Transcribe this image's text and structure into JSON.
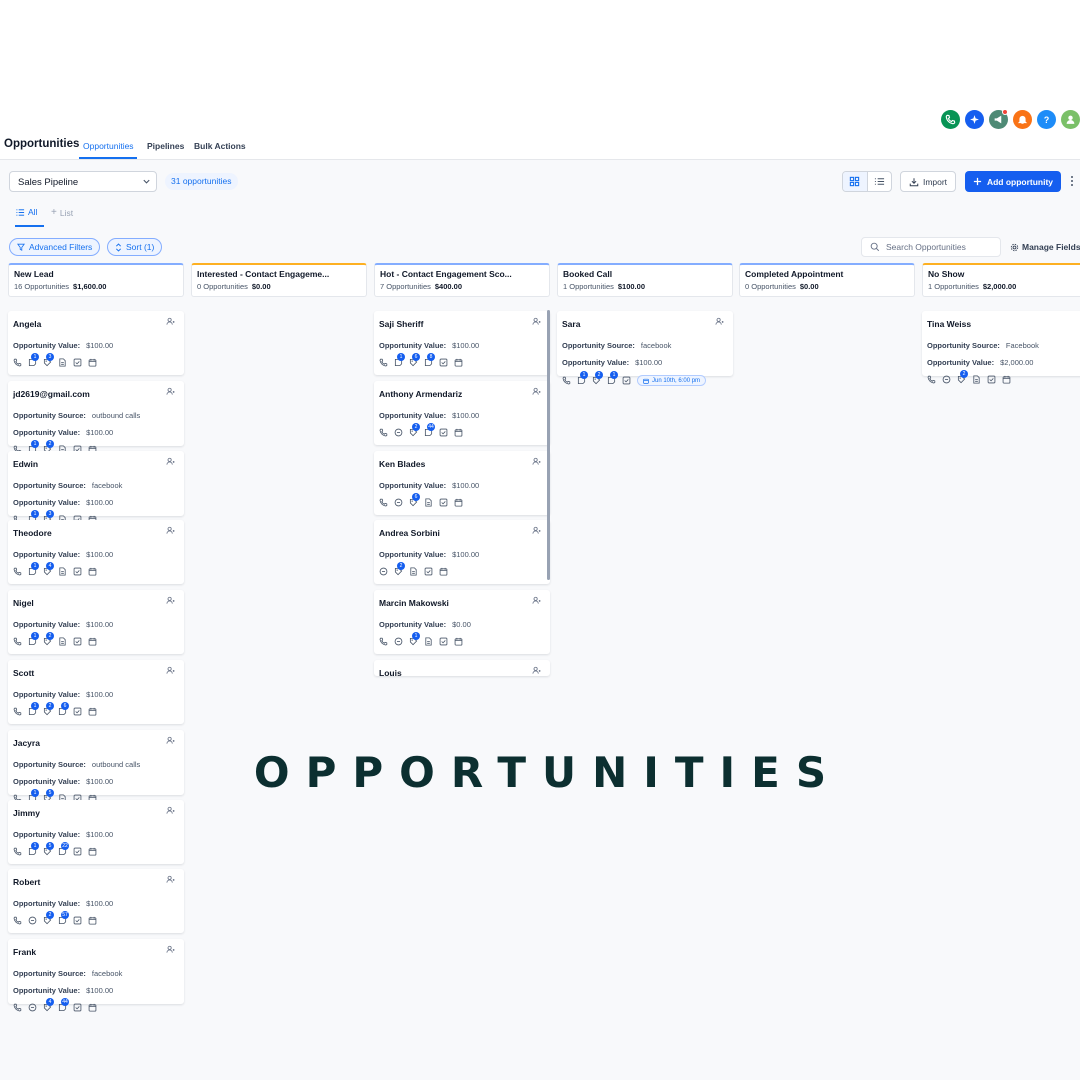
{
  "header": {
    "title": "Opportunities",
    "tabs": [
      {
        "label": "Opportunities",
        "active": true
      },
      {
        "label": "Pipelines",
        "active": false
      },
      {
        "label": "Bulk Actions",
        "active": false
      }
    ]
  },
  "top_icons": [
    {
      "icon": "phone-icon",
      "color": "#079455"
    },
    {
      "icon": "sparkle-icon",
      "color": "#155eef"
    },
    {
      "icon": "megaphone-icon",
      "color": "#4e8a75"
    },
    {
      "icon": "bell-icon",
      "color": "#f97316"
    },
    {
      "icon": "help-icon",
      "color": "#1d8cf8"
    },
    {
      "icon": "user-icon",
      "color": "#7ac068"
    }
  ],
  "toolbar": {
    "pipeline_select": "Sales Pipeline",
    "count_badge": "31 opportunities",
    "import_label": "Import",
    "add_label": "Add opportunity"
  },
  "views": {
    "all_label": "All",
    "list_label": "List"
  },
  "filters": {
    "advanced_label": "Advanced Filters",
    "sort_label": "Sort (1)",
    "search_placeholder": "Search Opportunities",
    "manage_fields_label": "Manage Fields"
  },
  "labels": {
    "value": "Opportunity Value:",
    "source": "Opportunity Source:"
  },
  "columns": [
    {
      "name": "New Lead",
      "meta": "16 Opportunities",
      "total": "$1,600.00",
      "color": "#84adff",
      "cards": [
        {
          "name": "Angela",
          "value": "$100.00",
          "source": null,
          "icons": [
            "phone",
            "note:1",
            "tag:3",
            "doc",
            "check",
            "cal"
          ]
        },
        {
          "name": "jd2619@gmail.com",
          "value": "$100.00",
          "source": "outbound calls",
          "icons": [
            "phone",
            "note:1",
            "tag:2",
            "doc",
            "check",
            "cal"
          ]
        },
        {
          "name": "Edwin",
          "value": "$100.00",
          "source": "facebook",
          "icons": [
            "phone",
            "note:1",
            "tag:3",
            "doc",
            "check",
            "cal"
          ]
        },
        {
          "name": "Theodore",
          "value": "$100.00",
          "source": null,
          "icons": [
            "phone",
            "note:1",
            "tag:4",
            "doc",
            "check",
            "cal"
          ]
        },
        {
          "name": "Nigel",
          "value": "$100.00",
          "source": null,
          "icons": [
            "phone",
            "note:1",
            "tag:2",
            "doc",
            "check",
            "cal"
          ]
        },
        {
          "name": "Scott",
          "value": "$100.00",
          "source": null,
          "icons": [
            "phone",
            "note:1",
            "tag:2",
            "note:6",
            "check",
            "cal"
          ]
        },
        {
          "name": "Jacyra",
          "value": "$100.00",
          "source": "outbound calls",
          "icons": [
            "phone",
            "note:1",
            "tag:5",
            "doc",
            "check",
            "cal"
          ]
        },
        {
          "name": "Jimmy",
          "value": "$100.00",
          "source": null,
          "icons": [
            "phone",
            "note:1",
            "tag:5",
            "note:22",
            "check",
            "cal"
          ]
        },
        {
          "name": "Robert",
          "value": "$100.00",
          "source": null,
          "icons": [
            "phone",
            "chat",
            "tag:2",
            "note:57",
            "check",
            "cal"
          ]
        },
        {
          "name": "Frank",
          "value": "$100.00",
          "source": "facebook",
          "icons": [
            "phone",
            "chat",
            "tag:4",
            "note:44",
            "check",
            "cal"
          ]
        }
      ]
    },
    {
      "name": "Interested - Contact Engageme...",
      "meta": "0 Opportunities",
      "total": "$0.00",
      "color": "#fdb022",
      "cards": []
    },
    {
      "name": "Hot - Contact Engagement Sco...",
      "meta": "7 Opportunities",
      "total": "$400.00",
      "color": "#84adff",
      "cards": [
        {
          "name": "Saji Sheriff",
          "value": "$100.00",
          "source": null,
          "icons": [
            "phone",
            "note:1",
            "tag:6",
            "note:8",
            "check",
            "cal"
          ]
        },
        {
          "name": "Anthony Armendariz",
          "value": "$100.00",
          "source": null,
          "icons": [
            "phone",
            "chat",
            "tag:2",
            "note:44",
            "check",
            "cal"
          ]
        },
        {
          "name": "Ken Blades",
          "value": "$100.00",
          "source": null,
          "icons": [
            "phone",
            "chat",
            "tag:6",
            "doc",
            "check",
            "cal"
          ]
        },
        {
          "name": "Andrea Sorbini",
          "value": "$100.00",
          "source": null,
          "icons": [
            "chat",
            "tag:2",
            "doc",
            "check",
            "cal"
          ]
        },
        {
          "name": "Marcin Makowski",
          "value": "$0.00",
          "source": null,
          "icons": [
            "phone",
            "chat",
            "tag:1",
            "doc",
            "check",
            "cal"
          ]
        },
        {
          "name": "Louis",
          "value": null,
          "source": null,
          "icons": []
        }
      ]
    },
    {
      "name": "Booked Call",
      "meta": "1 Opportunities",
      "total": "$100.00",
      "color": "#84adff",
      "cards": [
        {
          "name": "Sara",
          "value": "$100.00",
          "source": "facebook",
          "icons": [
            "phone",
            "note:1",
            "tag:2",
            "note:1",
            "check"
          ],
          "appointment": "Jun 10th, 6:00 pm"
        }
      ]
    },
    {
      "name": "Completed Appointment",
      "meta": "0 Opportunities",
      "total": "$0.00",
      "color": "#84adff",
      "cards": []
    },
    {
      "name": "No Show",
      "meta": "1 Opportunities",
      "total": "$2,000.00",
      "color": "#fdb022",
      "cards": [
        {
          "name": "Tina Weiss",
          "value": "$2,000.00",
          "source": "Facebook",
          "icons": [
            "phone",
            "chat",
            "tag:2",
            "doc",
            "check",
            "cal"
          ]
        }
      ]
    }
  ],
  "banner": "OPPORTUNITIES"
}
